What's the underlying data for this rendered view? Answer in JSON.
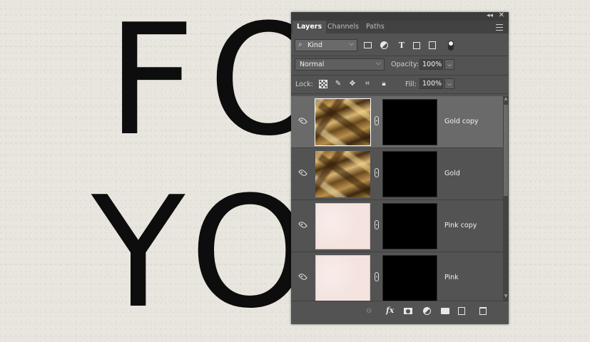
{
  "canvas": {
    "line1": "FO",
    "line2": "YO"
  },
  "panel": {
    "tabs": [
      {
        "label": "Layers",
        "active": true
      },
      {
        "label": "Channels",
        "active": false
      },
      {
        "label": "Paths",
        "active": false
      }
    ],
    "filter": {
      "kind_label": "Kind",
      "icons": [
        "image-filter-icon",
        "adjustment-filter-icon",
        "type-filter-icon",
        "shape-filter-icon",
        "smart-object-filter-icon",
        "filter-toggle-icon"
      ]
    },
    "blend_mode": "Normal",
    "opacity_label": "Opacity:",
    "opacity_value": "100%",
    "lock_label": "Lock:",
    "lock_icons": [
      "lock-transparent-pixels-icon",
      "lock-image-pixels-icon",
      "lock-position-icon",
      "lock-artboard-icon",
      "lock-all-icon"
    ],
    "fill_label": "Fill:",
    "fill_value": "100%",
    "layers": [
      {
        "name": "Gold copy",
        "thumb": "gold",
        "selected": true
      },
      {
        "name": "Gold",
        "thumb": "gold",
        "selected": false
      },
      {
        "name": "Pink copy",
        "thumb": "pink",
        "selected": false
      },
      {
        "name": "Pink",
        "thumb": "pink",
        "selected": false
      }
    ],
    "footer_icons": [
      "link-layers-icon",
      "fx-icon",
      "add-mask-icon",
      "new-adjustment-layer-icon",
      "new-group-icon",
      "new-layer-icon",
      "delete-layer-icon"
    ],
    "fx_label": "fx"
  },
  "colors": {
    "panel_bg": "#535353",
    "selected_row": "#6a6a6a",
    "canvas_bg": "#e9e6df",
    "text_color": "#0d0d0d"
  }
}
